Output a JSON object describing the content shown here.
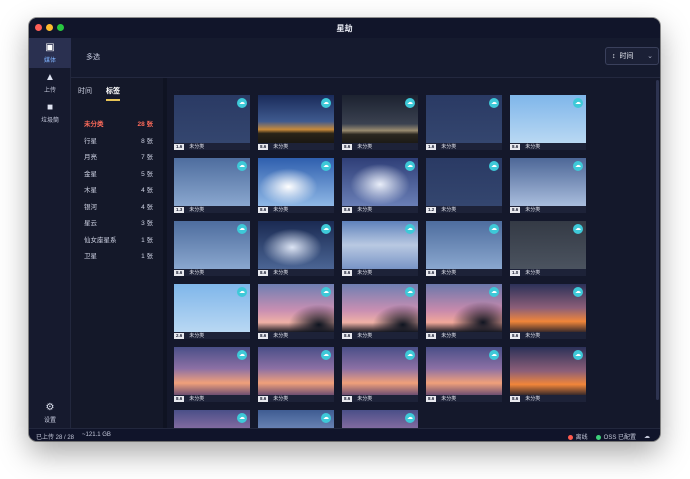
{
  "window": {
    "title": "星劫"
  },
  "rail": {
    "items": [
      {
        "label": "媒体",
        "icon": "media-icon"
      },
      {
        "label": "上传",
        "icon": "upload-icon"
      },
      {
        "label": "垃圾筒",
        "icon": "trash-icon"
      }
    ],
    "settings_label": "设置"
  },
  "toolbar": {
    "multi_select": "多选",
    "sort_label": "时间",
    "refresh_label": "刷新"
  },
  "panel": {
    "tabs": [
      "时间",
      "标签"
    ],
    "categories": [
      {
        "name": "未分类",
        "count": "28 张"
      },
      {
        "name": "行星",
        "count": "8 张"
      },
      {
        "name": "月亮",
        "count": "7 张"
      },
      {
        "name": "金星",
        "count": "5 张"
      },
      {
        "name": "木星",
        "count": "4 张"
      },
      {
        "name": "银河",
        "count": "4 张"
      },
      {
        "name": "星云",
        "count": "3 张"
      },
      {
        "name": "仙女座星系",
        "count": "1 张"
      },
      {
        "name": "卫星",
        "count": "1 张"
      }
    ]
  },
  "thumbs": [
    {
      "size": "1.6",
      "tag": "未分类",
      "sky": "night-dark"
    },
    {
      "size": "8.6",
      "tag": "未分类",
      "sky": "twilight-buildings"
    },
    {
      "size": "8.6",
      "tag": "未分类",
      "sky": "night-buildings"
    },
    {
      "size": "1.6",
      "tag": "未分类",
      "sky": "night-dark"
    },
    {
      "size": "8.6",
      "tag": "未分类",
      "sky": "day-blue"
    },
    {
      "size": "1.3",
      "tag": "未分类",
      "sky": "hazy-blue"
    },
    {
      "size": "8.6",
      "tag": "未分类",
      "sky": "wispy-clouds"
    },
    {
      "size": "8.6",
      "tag": "未分类",
      "sky": "streaky-clouds"
    },
    {
      "size": "1.2",
      "tag": "未分类",
      "sky": "night-dark"
    },
    {
      "size": "8.6",
      "tag": "未分类",
      "sky": "hazy-streak"
    },
    {
      "size": "8.6",
      "tag": "未分类",
      "sky": "hazy-blue"
    },
    {
      "size": "8.6",
      "tag": "未分类",
      "sky": "dramatic-clouds"
    },
    {
      "size": "8.6",
      "tag": "未分类",
      "sky": "cloud-band"
    },
    {
      "size": "8.6",
      "tag": "未分类",
      "sky": "hazy-blue"
    },
    {
      "size": "1.0",
      "tag": "未分类",
      "sky": "gray-dusk"
    },
    {
      "size": "2.6",
      "tag": "未分类",
      "sky": "day-blue"
    },
    {
      "size": "8.6",
      "tag": "未分类",
      "sky": "pink-sunset-trees"
    },
    {
      "size": "8.6",
      "tag": "未分类",
      "sky": "pink-sunset-trees"
    },
    {
      "size": "8.6",
      "tag": "未分类",
      "sky": "pink-sunset-tree"
    },
    {
      "size": "8.6",
      "tag": "未分类",
      "sky": "orange-sunset"
    },
    {
      "size": "8.6",
      "tag": "未分类",
      "sky": "purple-sunset"
    },
    {
      "size": "8.6",
      "tag": "未分类",
      "sky": "purple-sunset"
    },
    {
      "size": "8.6",
      "tag": "未分类",
      "sky": "purple-sunset"
    },
    {
      "size": "8.6",
      "tag": "未分类",
      "sky": "purple-sunset"
    },
    {
      "size": "8.6",
      "tag": "未分类",
      "sky": "orange-sunset"
    },
    {
      "size": "",
      "tag": "",
      "sky": "purple-sunset"
    },
    {
      "size": "",
      "tag": "",
      "sky": "blue-clouds"
    },
    {
      "size": "",
      "tag": "",
      "sky": "purple-sunset"
    }
  ],
  "status": {
    "uploaded": "已上传 28 / 28",
    "storage": "~121.1 GB",
    "offline": "离线",
    "oss": "OSS 已配置",
    "offline_color": "#ff5a4e",
    "oss_color": "#3dd07a"
  }
}
